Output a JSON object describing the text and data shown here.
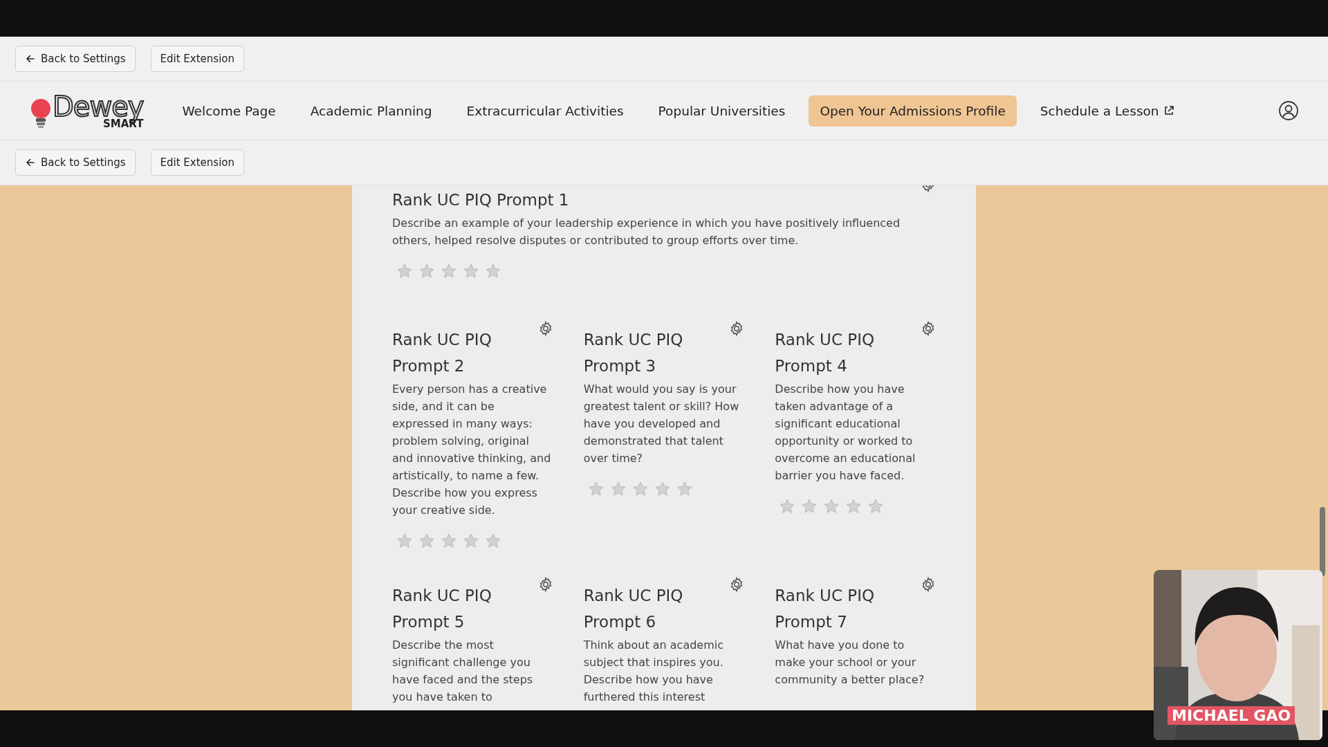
{
  "top_toolbar": {
    "back_button": {
      "label": "Back to Settings"
    },
    "edit_button": {
      "label": "Edit Extension"
    }
  },
  "nav": {
    "logo": {
      "word": "Dewey",
      "subtitle": "SMART"
    },
    "items": [
      {
        "label": "Welcome Page",
        "kind": "link",
        "selected": false
      },
      {
        "label": "Academic Planning",
        "kind": "link",
        "selected": false
      },
      {
        "label": "Extracurricular Activities",
        "kind": "link",
        "selected": false
      },
      {
        "label": "Popular Universities",
        "kind": "link",
        "selected": false
      },
      {
        "label": "Open Your Admissions Profile",
        "kind": "link",
        "selected": true
      },
      {
        "label": "Schedule a Lesson",
        "kind": "external",
        "selected": false
      }
    ]
  },
  "second_toolbar": {
    "back_button": {
      "label": "Back to Settings"
    },
    "edit_button": {
      "label": "Edit Extension"
    }
  },
  "prompts": [
    {
      "title": "Rank UC PIQ Prompt 1",
      "description": "Describe an example of your leadership experience in which you have positively influenced others, helped resolve disputes or contributed to group efforts over time.",
      "stars": 0,
      "wide": true
    },
    {
      "title": "Rank UC PIQ Prompt 2",
      "description": "Every person has a creative side, and it can be expressed in many ways: problem solving, original and innovative thinking, and artistically, to name a few. Describe how you express your creative side.",
      "stars": 0,
      "wide": false
    },
    {
      "title": "Rank UC PIQ Prompt 3",
      "description": "What would you say is your greatest talent or skill? How have you developed and demonstrated that talent over time?",
      "stars": 0,
      "wide": false
    },
    {
      "title": "Rank UC PIQ Prompt 4",
      "description": "Describe how you have taken advantage of a significant educational opportunity or worked to overcome an educational barrier you have faced.",
      "stars": 0,
      "wide": false
    },
    {
      "title": "Rank UC PIQ Prompt 5",
      "description": "Describe the most significant challenge you have faced and the steps you have taken to",
      "wide": false
    },
    {
      "title": "Rank UC PIQ Prompt 6",
      "description": "Think about an academic subject that inspires you. Describe how you have furthered this interest",
      "wide": false
    },
    {
      "title": "Rank UC PIQ Prompt 7",
      "description": "What have you done to make your school or your community a better place?",
      "wide": false
    }
  ],
  "video": {
    "kind": "picture",
    "name_tag": "MICHAEL GAO"
  }
}
